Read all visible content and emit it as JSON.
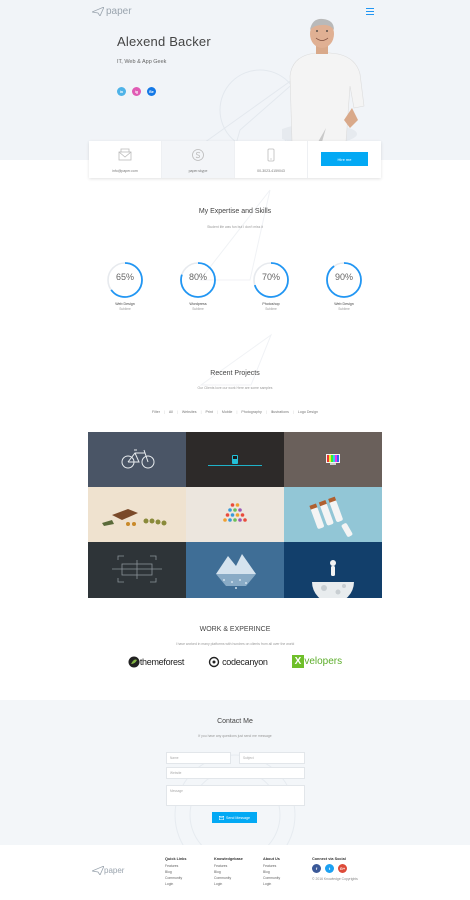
{
  "header": {
    "logo_text": "paper",
    "name": "Alexend Backer",
    "role": "IT, Web & App Geek",
    "social": [
      {
        "label": "in",
        "icon": "linkedin-icon",
        "color": "#4fb3e8"
      },
      {
        "label": "ig",
        "icon": "instagram-icon",
        "color": "#e05bb4"
      },
      {
        "label": "Be",
        "icon": "behance-icon",
        "color": "#1478e6"
      }
    ]
  },
  "info": {
    "email": "info@paper.com",
    "skype": "paper.skype",
    "phone": "00-3023-4159043",
    "hire_label": "Hire me"
  },
  "skills": {
    "title": "My Expertise and Skills",
    "subtitle": "Student life was fun but I don't miss it",
    "items": [
      {
        "value": 65,
        "label": "65%",
        "name": "Web Design",
        "sub": "Sublime"
      },
      {
        "value": 80,
        "label": "80%",
        "name": "Wordpress",
        "sub": "Sublime"
      },
      {
        "value": 70,
        "label": "70%",
        "name": "Photoshop",
        "sub": "Sublime"
      },
      {
        "value": 90,
        "label": "90%",
        "name": "Web Design",
        "sub": "Sublime"
      }
    ]
  },
  "projects": {
    "title": "Recent Projects",
    "subtitle": "Our Clients love our work Here are some samples",
    "filters": [
      "Filter",
      "All",
      "Websites",
      "Print",
      "Mobile",
      "Photography",
      "Illustrations",
      "Logo Design"
    ]
  },
  "work": {
    "title": "WORK & EXPERINCE",
    "subtitle": "I have worked in many platforms with hundres on clients from all over the world",
    "brands": [
      "themeforest",
      "codecanyon",
      "velopers"
    ],
    "brand_prefix": "X"
  },
  "contact": {
    "title": "Contact Me",
    "subtitle": "If you have any questions just send me message",
    "name_placeholder": "Name",
    "subject_placeholder": "Subject",
    "website_placeholder": "Website",
    "message_placeholder": "Message",
    "send_label": "Send Message"
  },
  "footer": {
    "logo_text": "paper",
    "columns": [
      {
        "title": "Quick Links",
        "items": [
          "Features",
          "Blog",
          "Community",
          "Login"
        ]
      },
      {
        "title": "Knowledgebase",
        "items": [
          "Features",
          "Blog",
          "Community",
          "Login"
        ]
      },
      {
        "title": "About Us",
        "items": [
          "Features",
          "Blog",
          "Community",
          "Login"
        ]
      }
    ],
    "social_title": "Connect via Social",
    "social": [
      {
        "label": "f",
        "color": "#3b5998"
      },
      {
        "label": "t",
        "color": "#1da1f2"
      },
      {
        "label": "G+",
        "color": "#dd4b39"
      }
    ],
    "copyright": "© 2016 Knowledge Copyrights"
  }
}
